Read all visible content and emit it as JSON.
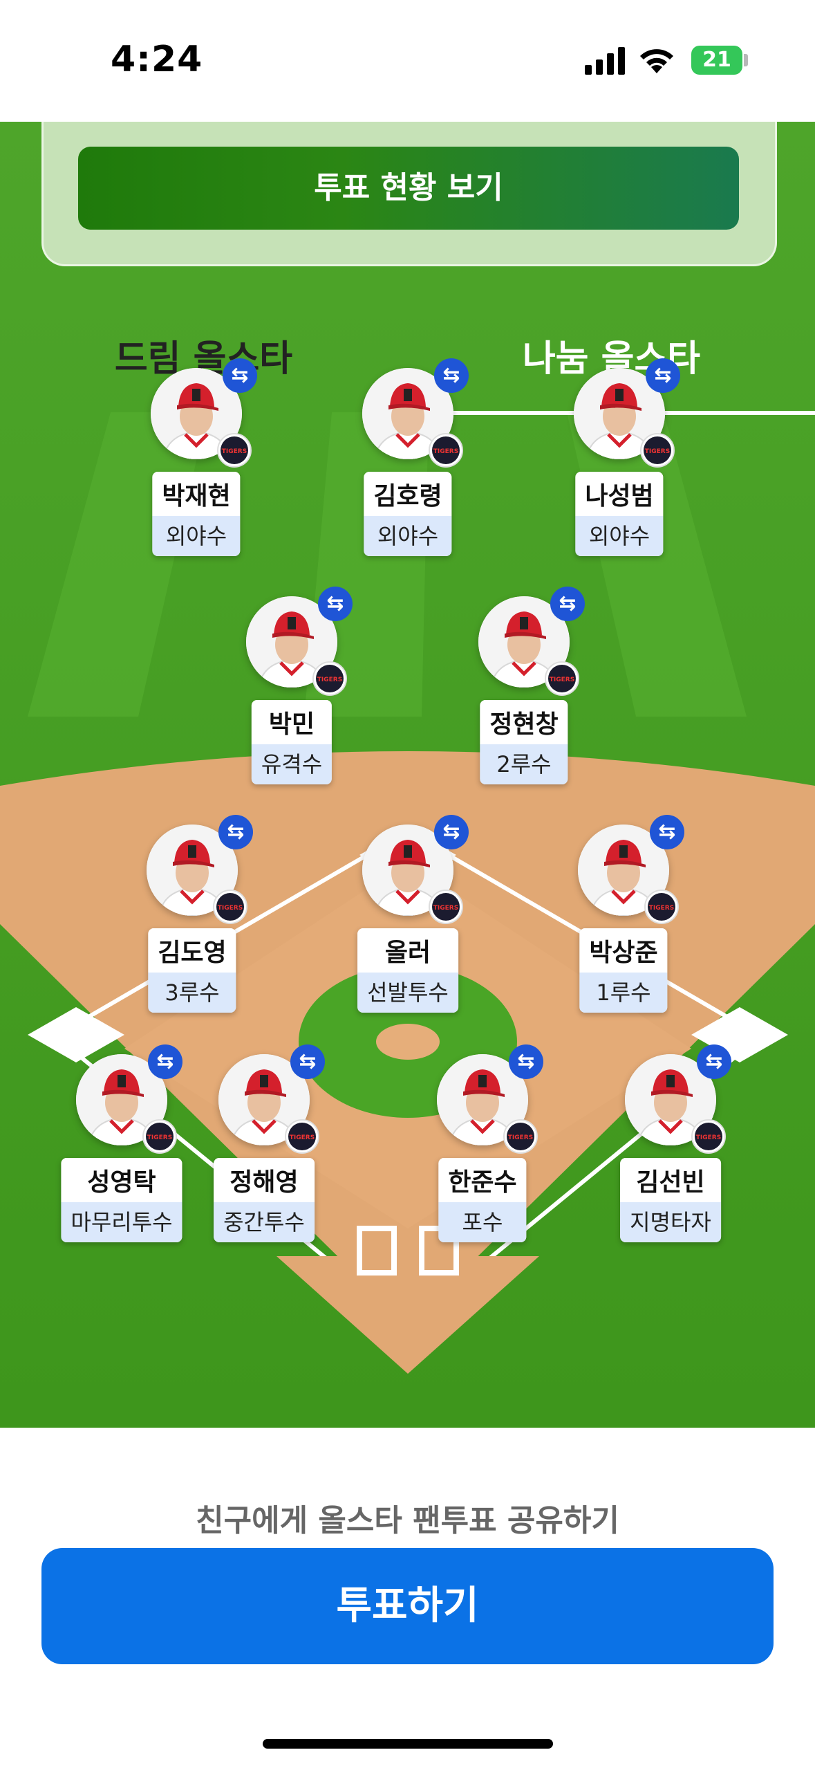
{
  "status_bar": {
    "time": "4:24",
    "battery": "21"
  },
  "vote_card": {
    "view_status_label": "투표 현황 보기"
  },
  "tabs": [
    {
      "label": "드림 올스타",
      "selected": false
    },
    {
      "label": "나눔 올스타",
      "selected": true
    }
  ],
  "players": [
    {
      "name": "박재현",
      "position": "외야수"
    },
    {
      "name": "김호령",
      "position": "외야수"
    },
    {
      "name": "나성범",
      "position": "외야수"
    },
    {
      "name": "박민",
      "position": "유격수"
    },
    {
      "name": "정현창",
      "position": "2루수"
    },
    {
      "name": "김도영",
      "position": "3루수"
    },
    {
      "name": "올러",
      "position": "선발투수"
    },
    {
      "name": "박상준",
      "position": "1루수"
    },
    {
      "name": "성영탁",
      "position": "마무리투수"
    },
    {
      "name": "정해영",
      "position": "중간투수"
    },
    {
      "name": "한준수",
      "position": "포수"
    },
    {
      "name": "김선빈",
      "position": "지명타자"
    }
  ],
  "team_logo_text": "TIGERS",
  "share_text": "친구에게 올스타 팬투표 공유하기",
  "vote_button": "투표하기",
  "colors": {
    "grass": "#4fa82a",
    "infield": "#e1a874",
    "vote_button": "#0b72e6",
    "swap_badge": "#1f55d6"
  }
}
